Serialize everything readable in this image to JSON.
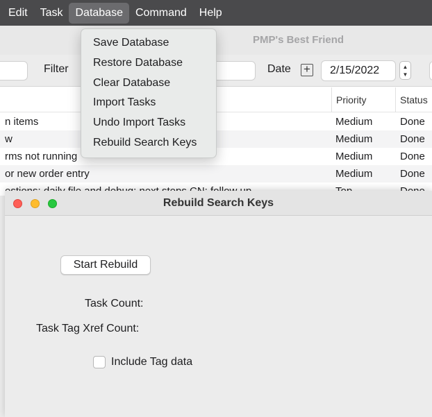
{
  "menubar": {
    "items": [
      {
        "label": "Edit"
      },
      {
        "label": "Task"
      },
      {
        "label": "Database"
      },
      {
        "label": "Command"
      },
      {
        "label": "Help"
      }
    ]
  },
  "main_window": {
    "title": "PMP's Best Friend",
    "toolbar": {
      "filter_label": "Filter",
      "date_label": "Date",
      "date_value": "2/15/2022"
    },
    "table": {
      "headers": {
        "priority": "Priority",
        "status": "Status"
      },
      "rows": [
        {
          "name": "n items",
          "priority": "Medium",
          "status": "Done"
        },
        {
          "name": "w",
          "priority": "Medium",
          "status": "Done"
        },
        {
          "name": "rms not running",
          "priority": "Medium",
          "status": "Done"
        },
        {
          "name": "or new order entry",
          "priority": "Medium",
          "status": "Done"
        },
        {
          "name": "estions: daily file and debug: next steps CN: follow up",
          "priority": "Top",
          "status": "Done"
        }
      ]
    }
  },
  "database_menu": {
    "items": [
      {
        "label": "Save Database"
      },
      {
        "label": "Restore Database"
      },
      {
        "label": "Clear Database"
      },
      {
        "label": "Import Tasks"
      },
      {
        "label": "Undo Import Tasks"
      },
      {
        "label": "Rebuild Search Keys"
      }
    ]
  },
  "dialog": {
    "title": "Rebuild Search Keys",
    "start_button": "Start Rebuild",
    "task_count_label": "Task Count:",
    "xref_count_label": "Task Tag Xref Count:",
    "include_tag_label": "Include Tag data",
    "include_tag_checked": false
  },
  "colors": {
    "menubar_bg": "#4a4a4c",
    "menu_active_bg": "#6b6b6e",
    "traffic_close": "#fe5f57",
    "traffic_minimize": "#febc2e",
    "traffic_maximize": "#28c840"
  }
}
